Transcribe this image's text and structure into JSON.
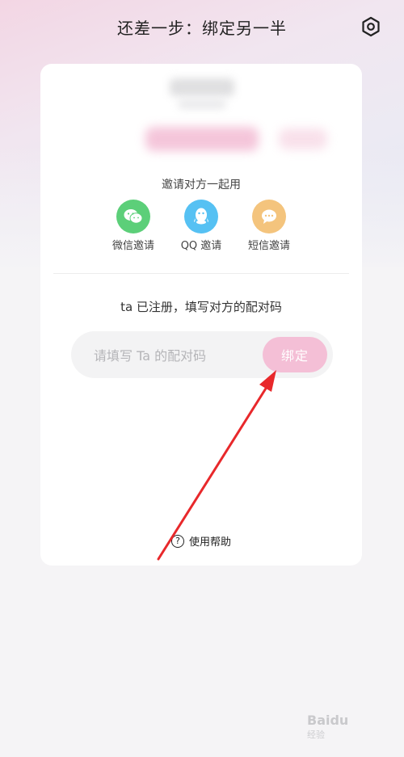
{
  "header": {
    "title": "还差一步：绑定另一半",
    "settings_icon": "settings-hexagon-icon"
  },
  "invite": {
    "label": "邀请对方一起用",
    "options": [
      {
        "label": "微信邀请",
        "icon": "wechat-icon",
        "color": "#5ccf79"
      },
      {
        "label": "QQ 邀请",
        "icon": "qq-icon",
        "color": "#56c1f3"
      },
      {
        "label": "短信邀请",
        "icon": "sms-icon",
        "color": "#f4c47d"
      }
    ]
  },
  "pair": {
    "registered_text": "ta 已注册，填写对方的配对码",
    "input_placeholder": "请填写 Ta 的配对码",
    "input_value": "",
    "bind_label": "绑定"
  },
  "help": {
    "label": "使用帮助",
    "icon": "question-circle-icon"
  },
  "watermark": {
    "logo": "Baidu",
    "sub": "经验"
  },
  "colors": {
    "accent_pink": "#f4bfd6",
    "annotation_red": "#e8282b"
  }
}
